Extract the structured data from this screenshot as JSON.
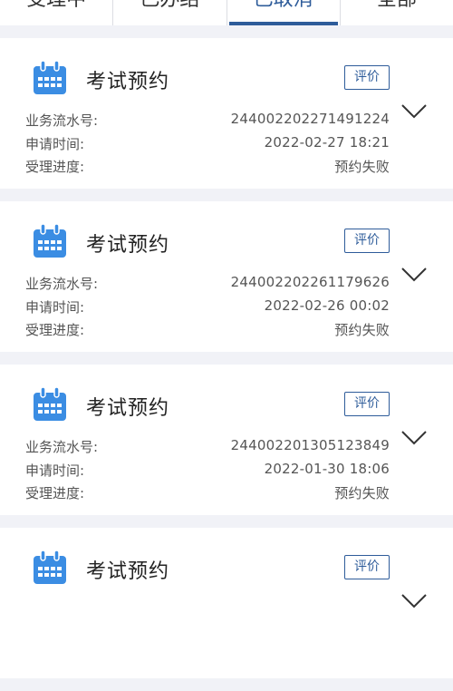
{
  "tabs": [
    {
      "label": "受理中",
      "active": false
    },
    {
      "label": "已办结",
      "active": false
    },
    {
      "label": "已取消",
      "active": true
    },
    {
      "label": "全部",
      "active": false
    }
  ],
  "labels": {
    "serial": "业务流水号:",
    "time": "申请时间:",
    "progress": "受理进度:"
  },
  "cards": [
    {
      "title": "考试预约",
      "eval_label": "评价",
      "serial": "244002202271491224",
      "time": "2022-02-27 18:21",
      "progress": "预约失败",
      "icon": "calendar-icon"
    },
    {
      "title": "考试预约",
      "eval_label": "评价",
      "serial": "244002202261179626",
      "time": "2022-02-26 00:02",
      "progress": "预约失败",
      "icon": "calendar-icon"
    },
    {
      "title": "考试预约",
      "eval_label": "评价",
      "serial": "244002201305123849",
      "time": "2022-01-30 18:06",
      "progress": "预约失败",
      "icon": "calendar-icon"
    },
    {
      "title": "考试预约",
      "eval_label": "评价",
      "serial": "",
      "time": "",
      "progress": "",
      "icon": "calendar-icon"
    }
  ],
  "colors": {
    "accent": "#2e5c9a",
    "icon": "#3b8de3",
    "background": "#f1f2f7"
  }
}
